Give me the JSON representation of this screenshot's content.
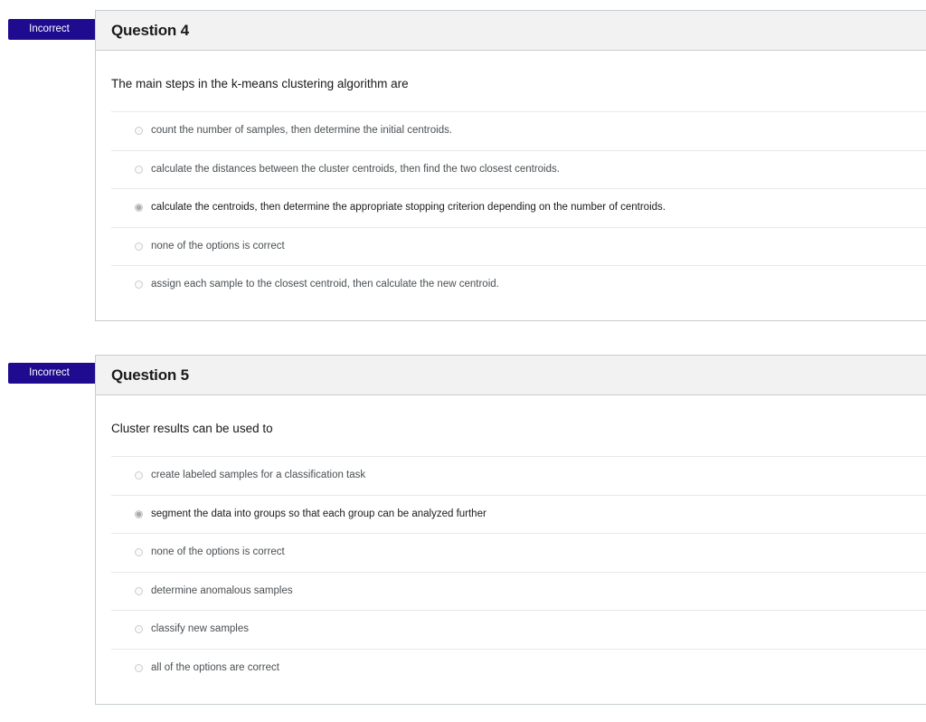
{
  "questions": [
    {
      "status": "Incorrect",
      "title": "Question 4",
      "prompt": "The main steps in the k-means clustering algorithm are",
      "answers": [
        {
          "label": "count the number of samples, then determine the initial centroids.",
          "selected": false
        },
        {
          "label": "calculate the distances between the cluster centroids, then find the two closest centroids.",
          "selected": false
        },
        {
          "label": "calculate the centroids, then determine the appropriate stopping criterion depending on the number of centroids.",
          "selected": true
        },
        {
          "label": "none of the options is correct",
          "selected": false
        },
        {
          "label": "assign each sample to the closest centroid, then calculate the new centroid.",
          "selected": false
        }
      ]
    },
    {
      "status": "Incorrect",
      "title": "Question 5",
      "prompt": "Cluster results can be used to",
      "answers": [
        {
          "label": "create labeled samples for a classification task",
          "selected": false
        },
        {
          "label": "segment the data into groups so that each group can be analyzed further",
          "selected": true
        },
        {
          "label": "none of the options is correct",
          "selected": false
        },
        {
          "label": "determine anomalous samples",
          "selected": false
        },
        {
          "label": "classify new samples",
          "selected": false
        },
        {
          "label": "all of the options are correct",
          "selected": false
        }
      ]
    }
  ],
  "colors": {
    "badge_bg": "#1f0b8f",
    "badge_text": "#ffffff",
    "header_bg": "#f2f2f2"
  }
}
